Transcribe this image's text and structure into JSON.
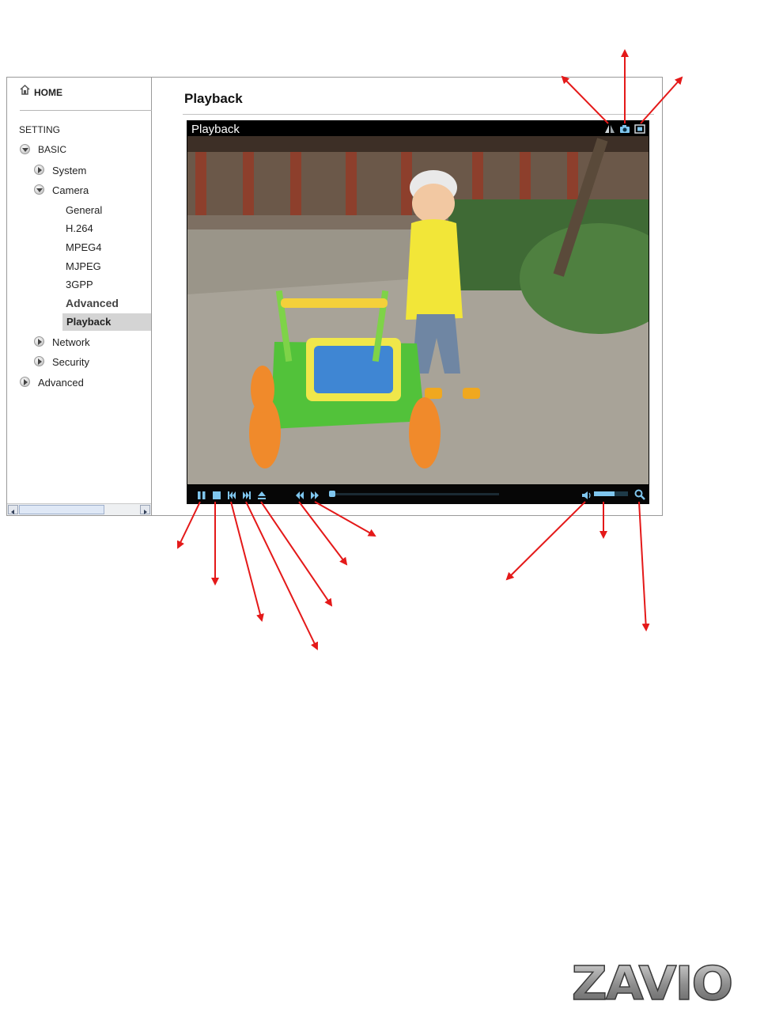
{
  "sidebar": {
    "home": "HOME",
    "setting": "SETTING",
    "items": [
      {
        "label": "BASIC"
      },
      {
        "label": "System"
      },
      {
        "label": "Camera"
      },
      {
        "label": "General"
      },
      {
        "label": "H.264"
      },
      {
        "label": "MPEG4"
      },
      {
        "label": "MJPEG"
      },
      {
        "label": "3GPP"
      },
      {
        "label": "Advanced"
      },
      {
        "label": "Playback"
      },
      {
        "label": "Network"
      },
      {
        "label": "Security"
      },
      {
        "label": "Advanced"
      }
    ],
    "selected": "Playback"
  },
  "main": {
    "title": "Playback"
  },
  "player": {
    "title": "Playback",
    "progress_fraction": 0.0,
    "volume_fraction": 0.6
  },
  "icons": {
    "toolbar": [
      "mirror-icon",
      "snapshot-icon",
      "fullscreen-icon"
    ],
    "controls": [
      "pause-icon",
      "stop-icon",
      "previous-icon",
      "next-icon",
      "eject-icon",
      "rewind-icon",
      "fast-forward-icon",
      "volume-icon",
      "zoom-icon"
    ]
  },
  "colors": {
    "accent": "#7fc6ee",
    "arrow": "#e41919",
    "selected_bg": "#d4d4d4"
  },
  "logo": {
    "text": "ZAVIO"
  }
}
